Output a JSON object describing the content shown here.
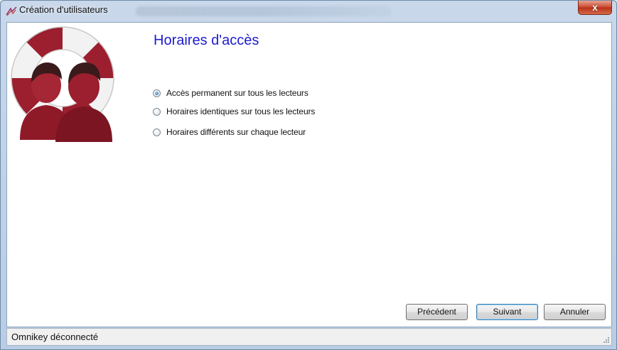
{
  "window": {
    "title": "Création d'utilisateurs",
    "close_glyph": "x",
    "icon": "people-link-icon"
  },
  "page": {
    "title": "Horaires d'accès"
  },
  "options": [
    {
      "label": "Accès permanent sur tous les lecteurs",
      "checked": true
    },
    {
      "label": "Horaires identiques sur tous les lecteurs",
      "checked": false
    },
    {
      "label": "Horaires différents sur chaque lecteur",
      "checked": false
    }
  ],
  "buttons": {
    "previous": "Précédent",
    "next": "Suivant",
    "cancel": "Annuler"
  },
  "status": {
    "text": "Omnikey déconnecté"
  },
  "colors": {
    "title_blue": "#1c1ccf",
    "logo_red": "#9b1f2e"
  }
}
